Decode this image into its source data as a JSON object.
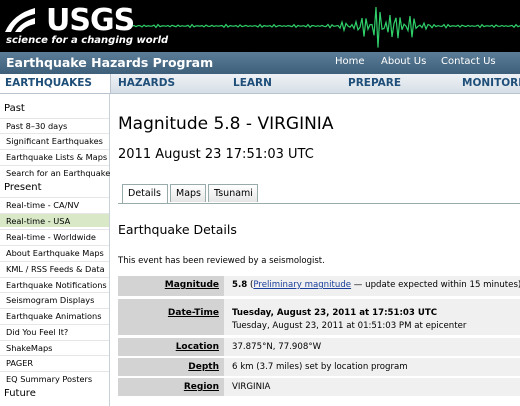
{
  "banner": {
    "logo_text": "USGS",
    "tagline": "science for a changing world"
  },
  "program": {
    "title": "Earthquake Hazards Program",
    "links": [
      "Home",
      "About Us",
      "Contact Us"
    ]
  },
  "nav": {
    "items": [
      "EARTHQUAKES",
      "HAZARDS",
      "LEARN",
      "PREPARE",
      "MONITORI"
    ]
  },
  "sidebar": {
    "sections": [
      {
        "heading": "Past",
        "items": [
          "Past 8–30 days",
          "Significant Earthquakes",
          "Earthquake Lists & Maps",
          "Search for an Earthquake"
        ]
      },
      {
        "heading": "Present",
        "items": [
          "Real-time - CA/NV",
          "Real-time - USA",
          "Real-time - Worldwide",
          "About Earthquake Maps",
          "KML / RSS Feeds & Data",
          "Earthquake Notifications",
          "Seismogram Displays",
          "Earthquake Animations",
          "Did You Feel It?",
          "ShakeMaps",
          "PAGER",
          "EQ Summary Posters"
        ]
      },
      {
        "heading": "Future",
        "items": []
      }
    ],
    "active_item": "Real-time - USA"
  },
  "content": {
    "title": "Magnitude 5.8 - VIRGINIA",
    "subtitle": "2011 August 23 17:51:03 UTC",
    "tabs": [
      "Details",
      "Maps",
      "Tsunami"
    ],
    "active_tab": "Details",
    "section_title": "Earthquake Details",
    "review_note": "This event has been reviewed by a seismologist.",
    "details": {
      "magnitude": {
        "label": "Magnitude",
        "value": "5.8",
        "link": "Preliminary magnitude",
        "note": " — update expected within 15 minutes)"
      },
      "datetime": {
        "label": "Date-Time",
        "line1": "Tuesday, August 23, 2011 at 17:51:03 UTC",
        "line2": "Tuesday, August 23, 2011 at 01:51:03 PM at epicenter"
      },
      "location": {
        "label": "Location",
        "value": "37.875°N, 77.908°W"
      },
      "depth": {
        "label": "Depth",
        "value": "6 km (3.7 miles) set by location program"
      },
      "region": {
        "label": "Region",
        "value": "VIRGINIA"
      }
    }
  },
  "colors": {
    "banner_bg": "#000000",
    "seismogram": "#2fd06a",
    "program_bar": "#4a6b86",
    "nav_text": "#1f4f79",
    "active_sidebar": "#d9e9c8",
    "link": "#1a3f9a"
  }
}
